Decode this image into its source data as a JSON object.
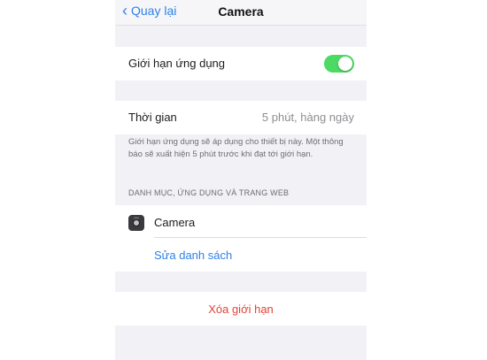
{
  "nav": {
    "back_label": "Quay lại",
    "title": "Camera"
  },
  "app_limit": {
    "label": "Giới hạn ứng dụng",
    "toggle_on": true
  },
  "time": {
    "label": "Thời gian",
    "value": "5 phút, hàng ngày"
  },
  "footer_note": "Giới hạn ứng dụng sẽ áp dụng cho thiết bị này. Một thông báo sẽ xuất hiện 5 phút trước khi đạt tới giới hạn.",
  "section_header": "DANH MỤC, ỨNG DỤNG VÀ TRANG WEB",
  "apps": [
    {
      "name": "Camera",
      "icon": "camera-icon"
    }
  ],
  "edit_list_label": "Sửa danh sách",
  "delete_limit_label": "Xóa giới hạn",
  "colors": {
    "accent": "#2f80e8",
    "toggle_on": "#4cd964",
    "destructive": "#e0443a",
    "background": "#f2f2f6"
  }
}
